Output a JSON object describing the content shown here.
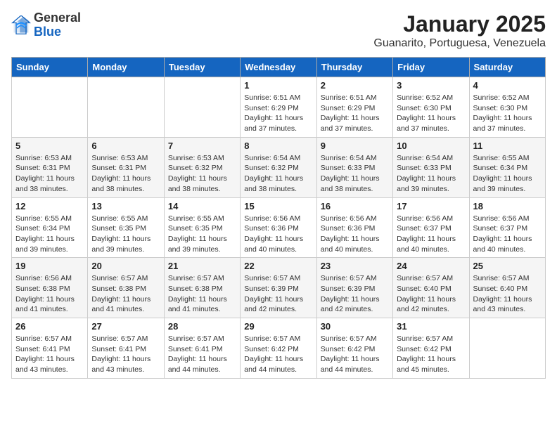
{
  "header": {
    "logo_general": "General",
    "logo_blue": "Blue",
    "title": "January 2025",
    "subtitle": "Guanarito, Portuguesa, Venezuela"
  },
  "calendar": {
    "weekdays": [
      "Sunday",
      "Monday",
      "Tuesday",
      "Wednesday",
      "Thursday",
      "Friday",
      "Saturday"
    ],
    "weeks": [
      [
        {
          "day": "",
          "info": ""
        },
        {
          "day": "",
          "info": ""
        },
        {
          "day": "",
          "info": ""
        },
        {
          "day": "1",
          "info": "Sunrise: 6:51 AM\nSunset: 6:29 PM\nDaylight: 11 hours and 37 minutes."
        },
        {
          "day": "2",
          "info": "Sunrise: 6:51 AM\nSunset: 6:29 PM\nDaylight: 11 hours and 37 minutes."
        },
        {
          "day": "3",
          "info": "Sunrise: 6:52 AM\nSunset: 6:30 PM\nDaylight: 11 hours and 37 minutes."
        },
        {
          "day": "4",
          "info": "Sunrise: 6:52 AM\nSunset: 6:30 PM\nDaylight: 11 hours and 37 minutes."
        }
      ],
      [
        {
          "day": "5",
          "info": "Sunrise: 6:53 AM\nSunset: 6:31 PM\nDaylight: 11 hours and 38 minutes."
        },
        {
          "day": "6",
          "info": "Sunrise: 6:53 AM\nSunset: 6:31 PM\nDaylight: 11 hours and 38 minutes."
        },
        {
          "day": "7",
          "info": "Sunrise: 6:53 AM\nSunset: 6:32 PM\nDaylight: 11 hours and 38 minutes."
        },
        {
          "day": "8",
          "info": "Sunrise: 6:54 AM\nSunset: 6:32 PM\nDaylight: 11 hours and 38 minutes."
        },
        {
          "day": "9",
          "info": "Sunrise: 6:54 AM\nSunset: 6:33 PM\nDaylight: 11 hours and 38 minutes."
        },
        {
          "day": "10",
          "info": "Sunrise: 6:54 AM\nSunset: 6:33 PM\nDaylight: 11 hours and 39 minutes."
        },
        {
          "day": "11",
          "info": "Sunrise: 6:55 AM\nSunset: 6:34 PM\nDaylight: 11 hours and 39 minutes."
        }
      ],
      [
        {
          "day": "12",
          "info": "Sunrise: 6:55 AM\nSunset: 6:34 PM\nDaylight: 11 hours and 39 minutes."
        },
        {
          "day": "13",
          "info": "Sunrise: 6:55 AM\nSunset: 6:35 PM\nDaylight: 11 hours and 39 minutes."
        },
        {
          "day": "14",
          "info": "Sunrise: 6:55 AM\nSunset: 6:35 PM\nDaylight: 11 hours and 39 minutes."
        },
        {
          "day": "15",
          "info": "Sunrise: 6:56 AM\nSunset: 6:36 PM\nDaylight: 11 hours and 40 minutes."
        },
        {
          "day": "16",
          "info": "Sunrise: 6:56 AM\nSunset: 6:36 PM\nDaylight: 11 hours and 40 minutes."
        },
        {
          "day": "17",
          "info": "Sunrise: 6:56 AM\nSunset: 6:37 PM\nDaylight: 11 hours and 40 minutes."
        },
        {
          "day": "18",
          "info": "Sunrise: 6:56 AM\nSunset: 6:37 PM\nDaylight: 11 hours and 40 minutes."
        }
      ],
      [
        {
          "day": "19",
          "info": "Sunrise: 6:56 AM\nSunset: 6:38 PM\nDaylight: 11 hours and 41 minutes."
        },
        {
          "day": "20",
          "info": "Sunrise: 6:57 AM\nSunset: 6:38 PM\nDaylight: 11 hours and 41 minutes."
        },
        {
          "day": "21",
          "info": "Sunrise: 6:57 AM\nSunset: 6:38 PM\nDaylight: 11 hours and 41 minutes."
        },
        {
          "day": "22",
          "info": "Sunrise: 6:57 AM\nSunset: 6:39 PM\nDaylight: 11 hours and 42 minutes."
        },
        {
          "day": "23",
          "info": "Sunrise: 6:57 AM\nSunset: 6:39 PM\nDaylight: 11 hours and 42 minutes."
        },
        {
          "day": "24",
          "info": "Sunrise: 6:57 AM\nSunset: 6:40 PM\nDaylight: 11 hours and 42 minutes."
        },
        {
          "day": "25",
          "info": "Sunrise: 6:57 AM\nSunset: 6:40 PM\nDaylight: 11 hours and 43 minutes."
        }
      ],
      [
        {
          "day": "26",
          "info": "Sunrise: 6:57 AM\nSunset: 6:41 PM\nDaylight: 11 hours and 43 minutes."
        },
        {
          "day": "27",
          "info": "Sunrise: 6:57 AM\nSunset: 6:41 PM\nDaylight: 11 hours and 43 minutes."
        },
        {
          "day": "28",
          "info": "Sunrise: 6:57 AM\nSunset: 6:41 PM\nDaylight: 11 hours and 44 minutes."
        },
        {
          "day": "29",
          "info": "Sunrise: 6:57 AM\nSunset: 6:42 PM\nDaylight: 11 hours and 44 minutes."
        },
        {
          "day": "30",
          "info": "Sunrise: 6:57 AM\nSunset: 6:42 PM\nDaylight: 11 hours and 44 minutes."
        },
        {
          "day": "31",
          "info": "Sunrise: 6:57 AM\nSunset: 6:42 PM\nDaylight: 11 hours and 45 minutes."
        },
        {
          "day": "",
          "info": ""
        }
      ]
    ]
  }
}
